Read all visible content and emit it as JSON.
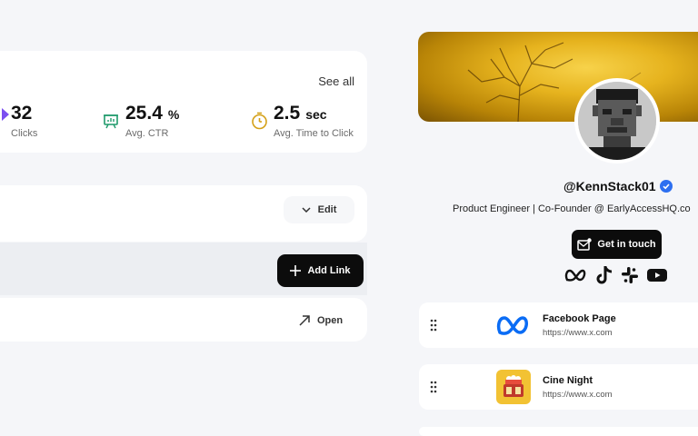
{
  "stats": {
    "see_all": "See all",
    "clicks": {
      "value": "32",
      "label": "Clicks"
    },
    "ctr": {
      "value": "25.4",
      "unit": "%",
      "label": "Avg. CTR"
    },
    "time": {
      "value": "2.5",
      "unit": "sec",
      "label": "Avg. Time to Click"
    }
  },
  "actions": {
    "edit": "Edit",
    "add_link": "Add Link",
    "open": "Open"
  },
  "profile": {
    "handle": "@KennStack01",
    "bio": "Product Engineer | Co-Founder @ EarlyAccessHQ.co",
    "cta": "Get in touch",
    "socials": [
      "meta-icon",
      "tiktok-icon",
      "slack-icon",
      "youtube-icon"
    ]
  },
  "links": [
    {
      "title": "Facebook Page",
      "url": "https://www.x.com",
      "icon": "meta-logo-icon"
    },
    {
      "title": "Cine Night",
      "url": "https://www.x.com",
      "icon": "cinema-icon"
    }
  ],
  "colors": {
    "accent_dark": "#0c0c0c",
    "meta_blue": "#0a6cf5",
    "verified_blue": "#2d6ff0",
    "ctr_green": "#1f9a6b",
    "time_amber": "#d4a017"
  }
}
